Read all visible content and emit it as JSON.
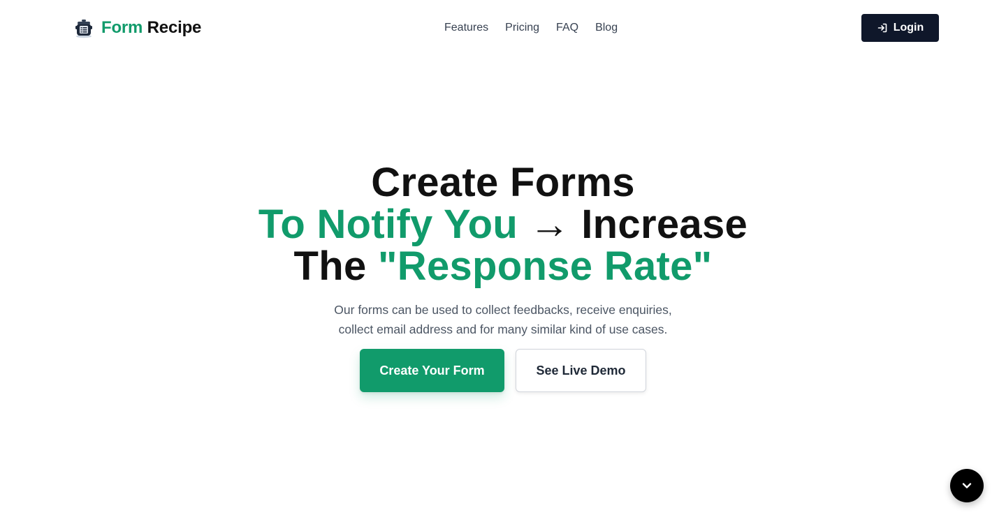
{
  "brand": {
    "name_part1": "Form",
    "name_part2": "Recipe",
    "logo_icon": "cooking-pot-form-icon"
  },
  "nav": {
    "items": [
      {
        "label": "Features"
      },
      {
        "label": "Pricing"
      },
      {
        "label": "FAQ"
      },
      {
        "label": "Blog"
      }
    ]
  },
  "header": {
    "login_label": "Login",
    "login_icon": "login-arrow-icon"
  },
  "hero": {
    "line1": "Create Forms",
    "line2_accent": "To Notify You",
    "line2_arrow": "→",
    "line2_rest": "Increase",
    "line3_start": "The",
    "line3_accent": "\"Response Rate\"",
    "subtitle_line1": "Our forms can be used to collect feedbacks, receive enquiries,",
    "subtitle_line2": "collect email address and for many similar kind of use cases."
  },
  "cta": {
    "primary_label": "Create Your Form",
    "secondary_label": "See Live Demo"
  },
  "scroll": {
    "icon": "chevron-down-icon"
  },
  "colors": {
    "accent": "#119b6b",
    "dark": "#0f172a",
    "text": "#111111",
    "muted": "#4b5563"
  }
}
